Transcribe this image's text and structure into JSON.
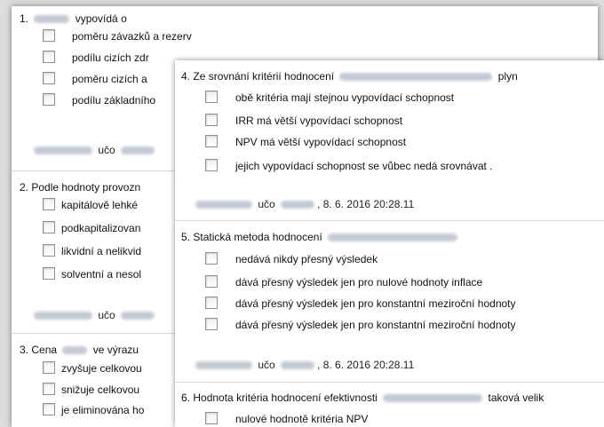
{
  "back_panel": {
    "questions": [
      {
        "number": "1.",
        "title_suffix": "vypovídá o",
        "options": [
          "poměru závazků a rezerv",
          "podílu cizích zdr",
          "poměru cizích a",
          "podílu základního"
        ],
        "author_uco": "učo"
      },
      {
        "number": "2.",
        "title": "Podle hodnoty provozn",
        "options": [
          "kapitálově lehké",
          "podkapitalizovan",
          "likvidní a nelikvid",
          "solventní a nesol"
        ],
        "author_uco": "učo"
      },
      {
        "number": "3.",
        "title": "Cena",
        "title_suffix": "ve výrazu",
        "options": [
          "zvyšuje celkovou",
          "snižuje celkovou",
          "je eliminována ho"
        ]
      }
    ]
  },
  "front_panel": {
    "questions": [
      {
        "number": "4.",
        "title": "Ze srovnání kritérií hodnocení",
        "title_suffix": "plyn",
        "options": [
          "obě kritéria mají stejnou vypovídací schopnost",
          "IRR má větší vypovídací schopnost",
          "NPV má větší vypovídací schopnost",
          "jejich vypovídací schopnost se vůbec nedá srovnávat ."
        ],
        "author_uco": "učo",
        "timestamp": ", 8. 6. 2016 20:28.11"
      },
      {
        "number": "5.",
        "title": "Statická metoda hodnocení",
        "options": [
          "nedává nikdy přesný výsledek",
          "dává  přesný výsledek jen pro nulové hodnoty inflace",
          "dává přesný výsledek jen pro konstantní meziroční hodnoty",
          "dává přesný výsledek jen pro konstantní meziroční hodnoty"
        ],
        "author_uco": "učo",
        "timestamp": ", 8. 6. 2016 20:28.11"
      },
      {
        "number": "6.",
        "title": "Hodnota kritéria hodnocení efektivnosti",
        "title_suffix": "taková velik",
        "options": [
          "nulové hodnotě kritéria NPV"
        ]
      }
    ]
  }
}
